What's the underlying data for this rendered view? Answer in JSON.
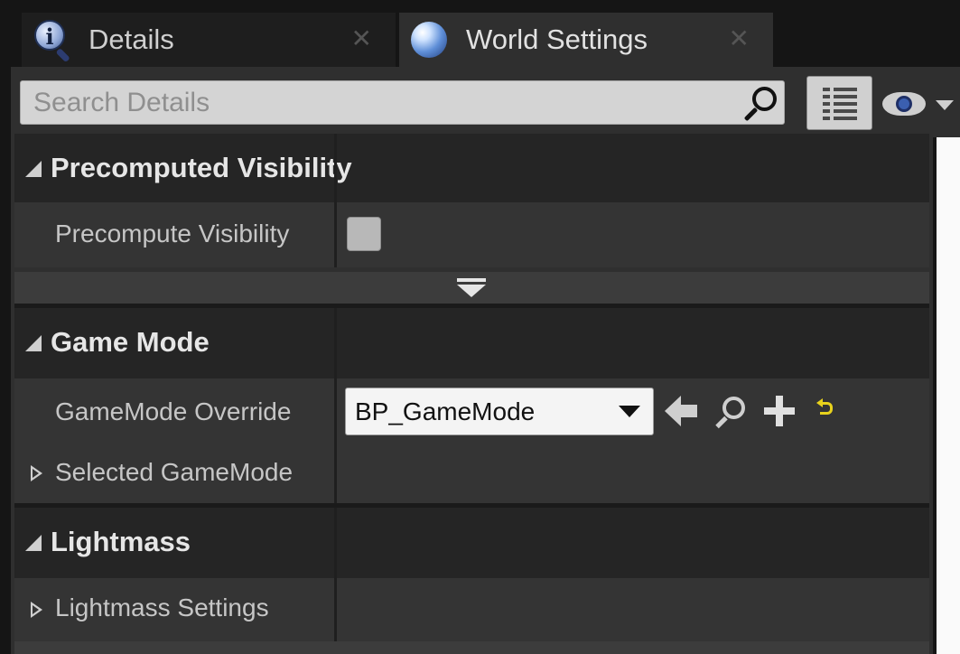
{
  "tabs": [
    {
      "label": "Details",
      "icon": "info-magnifier-icon",
      "active": false
    },
    {
      "label": "World Settings",
      "icon": "globe-icon",
      "active": true
    }
  ],
  "tab_close_glyph": "✕",
  "search": {
    "placeholder": "Search Details",
    "value": ""
  },
  "toolbar": {
    "view_options_icon": "list-view-icon",
    "visibility_icon": "eye-icon"
  },
  "categories": {
    "precomputed_visibility": {
      "title": "Precomputed Visibility",
      "properties": {
        "precompute_visibility": {
          "label": "Precompute Visibility",
          "checked": false
        }
      }
    },
    "game_mode": {
      "title": "Game Mode",
      "properties": {
        "gamemode_override": {
          "label": "GameMode Override",
          "value": "BP_GameMode"
        },
        "selected_gamemode": {
          "label": "Selected GameMode",
          "expanded": false
        }
      }
    },
    "lightmass": {
      "title": "Lightmass",
      "properties": {
        "lightmass_settings": {
          "label": "Lightmass Settings",
          "expanded": false
        }
      }
    }
  },
  "colors": {
    "panel_bg": "#2f2f2f",
    "category_bg": "#252525",
    "reset_accent": "#e8d21c"
  }
}
